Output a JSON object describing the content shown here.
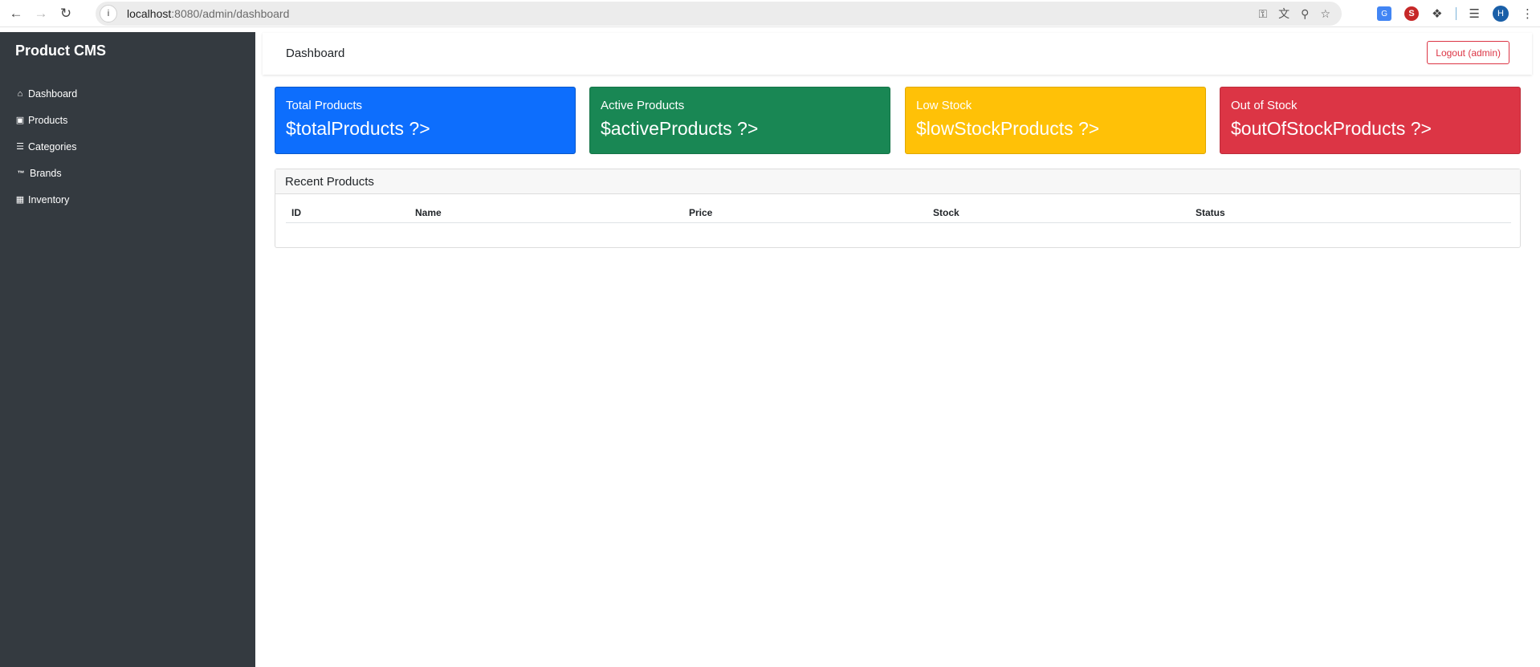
{
  "browser": {
    "url_host": "localhost",
    "url_path": ":8080/admin/dashboard",
    "profile_initial": "H"
  },
  "sidebar": {
    "brand": "Product CMS",
    "items": [
      {
        "label": "Dashboard",
        "icon": "home-icon"
      },
      {
        "label": "Products",
        "icon": "box-icon"
      },
      {
        "label": "Categories",
        "icon": "list-icon"
      },
      {
        "label": "Brands",
        "icon": "trademark-icon"
      },
      {
        "label": "Inventory",
        "icon": "warehouse-icon"
      }
    ]
  },
  "topbar": {
    "title": "Dashboard",
    "logout_label": "Logout (admin)"
  },
  "stats": [
    {
      "label": "Total Products",
      "value": "$totalProducts ?>",
      "color": "#0d6efd"
    },
    {
      "label": "Active Products",
      "value": "$activeProducts ?>",
      "color": "#198754"
    },
    {
      "label": "Low Stock",
      "value": "$lowStockProducts ?>",
      "color": "#ffc107"
    },
    {
      "label": "Out of Stock",
      "value": "$outOfStockProducts ?>",
      "color": "#dc3545"
    }
  ],
  "recent": {
    "title": "Recent Products",
    "columns": [
      "ID",
      "Name",
      "Price",
      "Stock",
      "Status"
    ]
  }
}
